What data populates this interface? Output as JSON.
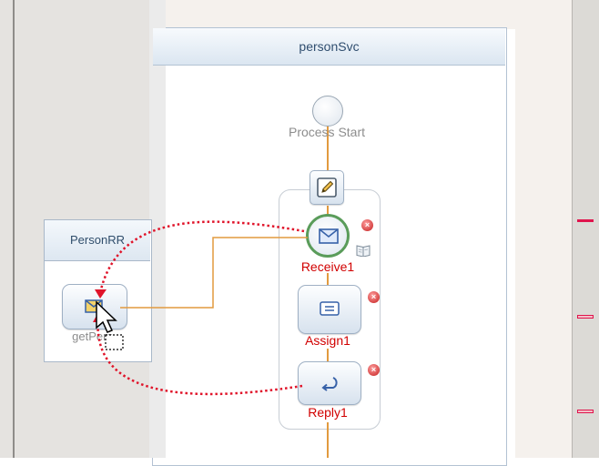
{
  "process": {
    "title": "personSvc",
    "start_label": "Process Start"
  },
  "partner": {
    "title": "PersonRR",
    "operation_label": "getPers..."
  },
  "activities": {
    "receive": "Receive1",
    "assign": "Assign1",
    "reply": "Reply1"
  },
  "colors": {
    "flow_line": "#e29a3f",
    "error_label": "#d10000",
    "drag_link": "#e0142a",
    "receive_ring": "#5a9c5a"
  },
  "icons": {
    "edit": "pencil-edit-icon",
    "receive": "envelope-icon",
    "assign": "assign-icon",
    "reply": "reply-arrow-icon",
    "error": "error-badge-icon",
    "book": "book-icon",
    "cursor": "arrow-cursor-icon"
  }
}
